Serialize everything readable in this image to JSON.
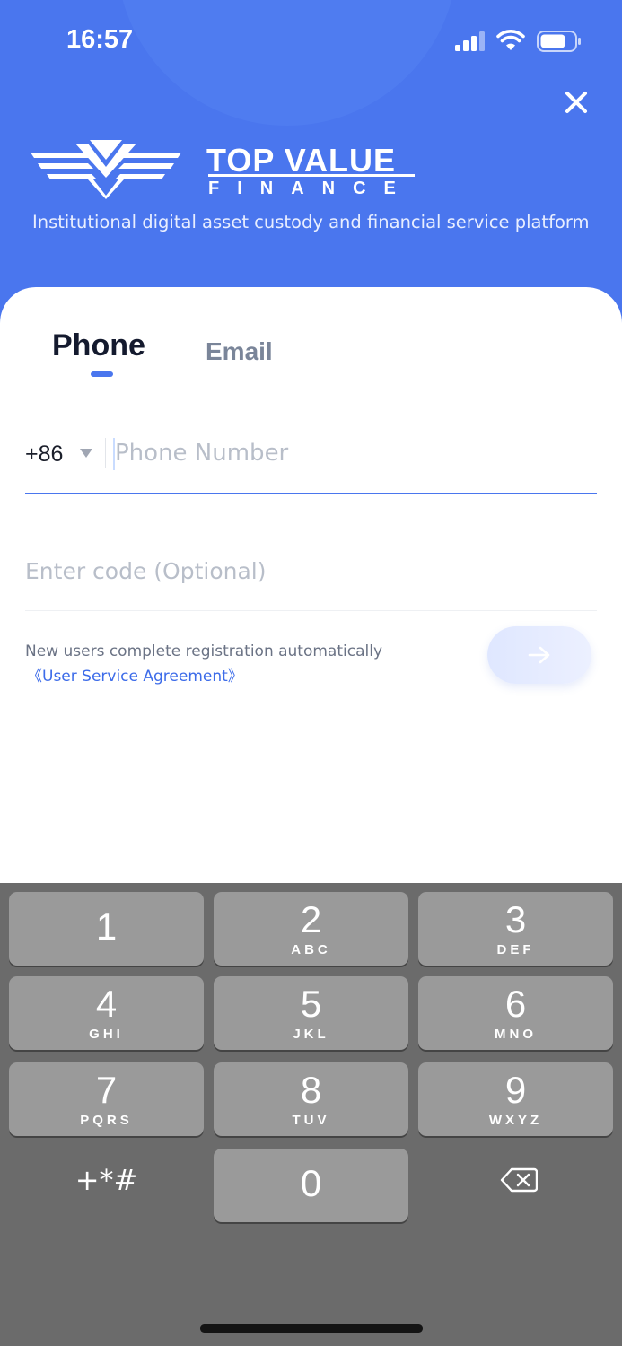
{
  "status_bar": {
    "time": "16:57",
    "icons": [
      "cellular-signal-icon",
      "wifi-icon",
      "battery-icon"
    ]
  },
  "header": {
    "close_icon": "close-icon",
    "logo": {
      "name_line1": "TOP VALUE",
      "name_line2": "FINANCE"
    },
    "tagline": "Institutional digital asset custody and financial service platform"
  },
  "login": {
    "tabs": [
      {
        "label": "Phone",
        "active": true
      },
      {
        "label": "Email",
        "active": false
      }
    ],
    "country_code": "+86",
    "phone_placeholder": "Phone Number",
    "code_placeholder": "Enter code (Optional)",
    "note": "New users complete registration automatically",
    "agreement_link": "《User Service Agreement》",
    "submit_icon": "arrow-right-icon"
  },
  "keypad": {
    "keys": [
      {
        "digit": "1",
        "letters": ""
      },
      {
        "digit": "2",
        "letters": "ABC"
      },
      {
        "digit": "3",
        "letters": "DEF"
      },
      {
        "digit": "4",
        "letters": "GHI"
      },
      {
        "digit": "5",
        "letters": "JKL"
      },
      {
        "digit": "6",
        "letters": "MNO"
      },
      {
        "digit": "7",
        "letters": "PQRS"
      },
      {
        "digit": "8",
        "letters": "TUV"
      },
      {
        "digit": "9",
        "letters": "WXYZ"
      },
      {
        "digit": "0",
        "letters": ""
      }
    ],
    "special_label": "+*#",
    "delete_icon": "backspace-icon"
  },
  "colors": {
    "brand_blue": "#4a76ee",
    "link_blue": "#3d6ce9",
    "heading": "#141a2e",
    "muted": "#7a8599",
    "placeholder": "#b8bec9",
    "keypad_bg": "#6b6b6b",
    "key_bg": "#9a9a9a"
  }
}
